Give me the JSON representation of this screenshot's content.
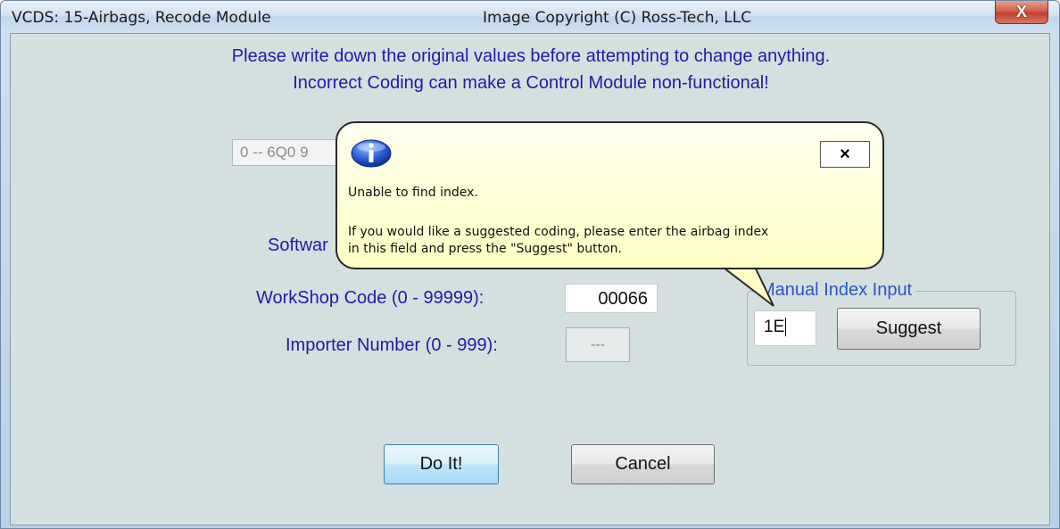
{
  "window": {
    "title_left": "VCDS: 15-Airbags,  Recode Module",
    "title_center": "Image Copyright (C) Ross-Tech, LLC",
    "close_glyph": "X"
  },
  "warning": {
    "line1": "Please write down the original values before attempting to change anything.",
    "line2": "Incorrect Coding can make a Control Module non-functional!"
  },
  "module_combo": {
    "value": "0 -- 6Q0 9"
  },
  "fields": {
    "software_label": "Softwar",
    "workshop_label": "WorkShop Code (0 - 99999):",
    "workshop_value": "00066",
    "importer_label": "Importer Number (0 - 999):",
    "importer_value": "---"
  },
  "manual_index": {
    "legend": "Manual Index Input",
    "value": "1E",
    "suggest_label": "Suggest"
  },
  "buttons": {
    "do_it": "Do It!",
    "cancel": "Cancel"
  },
  "tooltip": {
    "close_glyph": "×",
    "line1": "Unable to find index.",
    "line2": "If you would like a suggested coding, please enter the airbag index",
    "line3": "in this field and press the \"Suggest\" button.",
    "icon": "info-icon"
  },
  "colors": {
    "label_text": "#1c1ca8",
    "group_legend": "#2a56c6",
    "client_bg": "#d4e0df",
    "tooltip_bg": "#ffffc4",
    "close_button": "#c04030"
  }
}
